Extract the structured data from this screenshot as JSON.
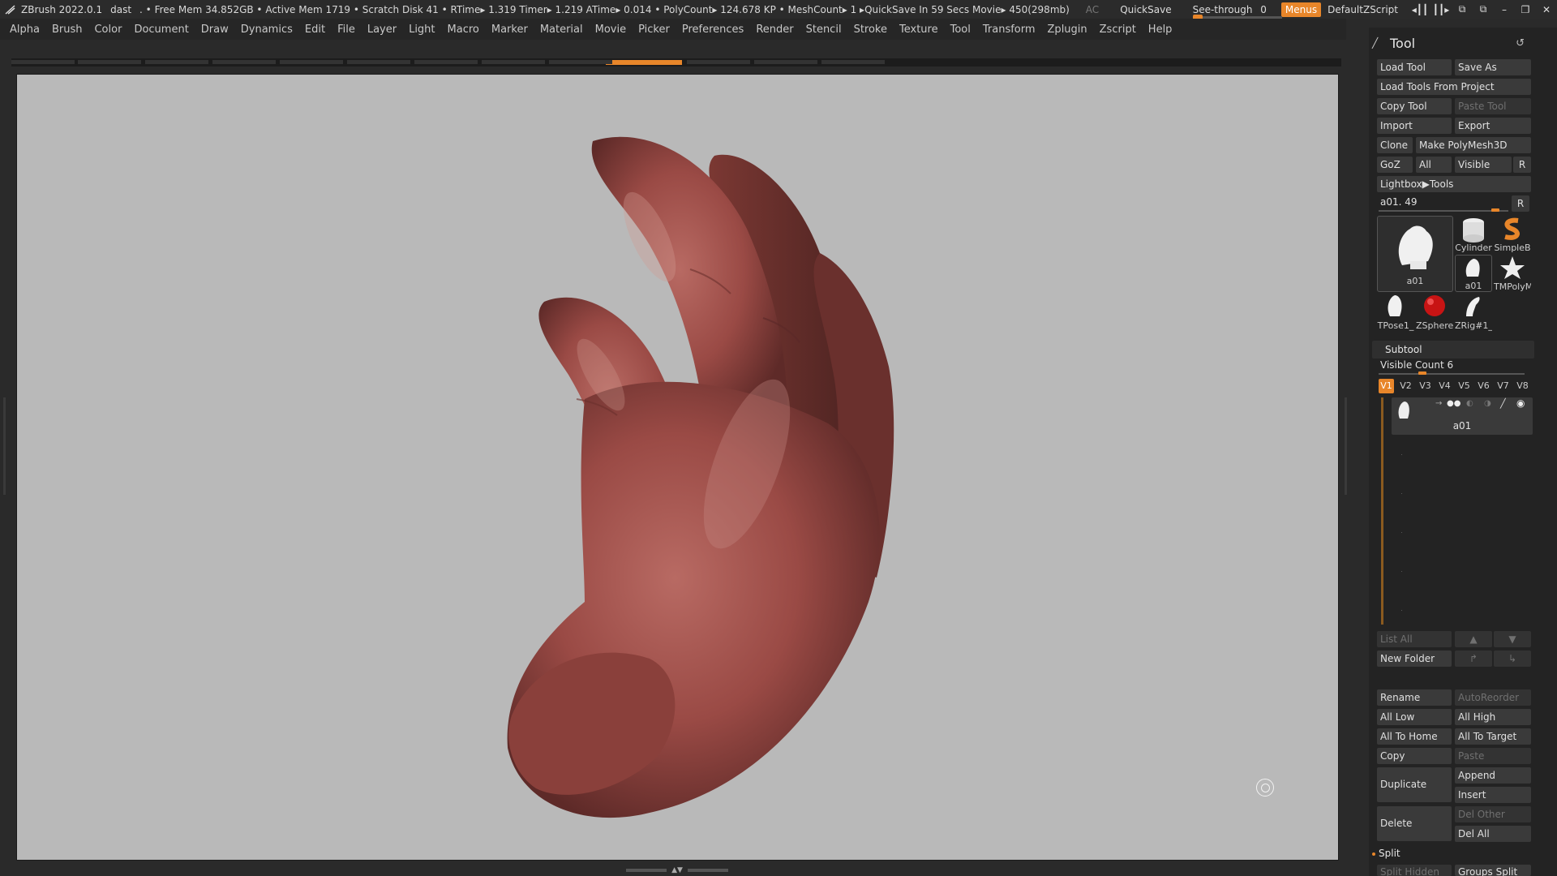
{
  "titlebar": {
    "app": "ZBrush 2022.0.1",
    "project": "dast",
    "status": ". • Free Mem 34.852GB • Active Mem 1719 • Scratch Disk 41 •  RTime▸ 1.319 Timer▸ 1.219 ATime▸ 0.014 • PolyCount▸ 124.678 KP  • MeshCount▸ 1  ▸QuickSave In 59 Secs Movie▸ 450(298mb)",
    "ac": "AC",
    "quicksave": "QuickSave",
    "see_through": "See-through",
    "see_through_value": "0",
    "menus": "Menus",
    "default_zscript": "DefaultZScript"
  },
  "menubar": [
    "Alpha",
    "Brush",
    "Color",
    "Document",
    "Draw",
    "Dynamics",
    "Edit",
    "File",
    "Layer",
    "Light",
    "Macro",
    "Marker",
    "Material",
    "Movie",
    "Picker",
    "Preferences",
    "Render",
    "Stencil",
    "Stroke",
    "Texture",
    "Tool",
    "Transform",
    "Zplugin",
    "Zscript",
    "Help"
  ],
  "tool_panel": {
    "title": "Tool",
    "buttons": {
      "load_tool": "Load Tool",
      "save_as": "Save As",
      "load_tools_from_project": "Load Tools From Project",
      "copy_tool": "Copy Tool",
      "paste_tool": "Paste Tool",
      "import": "Import",
      "export": "Export",
      "clone": "Clone",
      "make_polymesh3d": "Make PolyMesh3D",
      "goz": "GoZ",
      "all": "All",
      "visible": "Visible",
      "r": "R",
      "lightbox_tools": "Lightbox▶Tools"
    },
    "tool_slider": {
      "label": "a01. 49",
      "r": "R",
      "fraction": 0.9
    },
    "thumbnails": [
      {
        "label": "a01",
        "icon": "hand-model-icon"
      },
      {
        "label": "Cylinder",
        "icon": "cylinder-icon"
      },
      {
        "label": "SimpleB",
        "icon": "simple-brush-icon"
      },
      {
        "label": "a01",
        "icon": "hand-model-icon"
      },
      {
        "label": "TMPolyM",
        "icon": "star-polymesh-icon"
      },
      {
        "label": "TPose1_",
        "icon": "hand-model-icon"
      },
      {
        "label": "ZSphere",
        "icon": "zsphere-icon"
      },
      {
        "label": "ZRig#1_",
        "icon": "zrig-icon"
      }
    ]
  },
  "subtool": {
    "title": "Subtool",
    "visible_count_label": "Visible Count 6",
    "visible_count_fraction": 0.3,
    "view_tabs": [
      "V1",
      "V2",
      "V3",
      "V4",
      "V5",
      "V6",
      "V7",
      "V8"
    ],
    "active_tab": "V1",
    "items": [
      {
        "name": "a01"
      }
    ],
    "list_all": "List All",
    "new_folder": "New Folder",
    "rename": "Rename",
    "auto_reorder": "AutoReorder",
    "all_low": "All Low",
    "all_high": "All High",
    "all_to_home": "All To Home",
    "all_to_target": "All To Target",
    "copy": "Copy",
    "paste": "Paste",
    "duplicate": "Duplicate",
    "append": "Append",
    "insert": "Insert",
    "delete": "Delete",
    "del_other": "Del Other",
    "del_all": "Del All"
  },
  "split": {
    "title": "Split",
    "split_hidden": "Split Hidden",
    "groups_split": "Groups Split"
  },
  "colors": {
    "accent": "#e8862a",
    "canvas_bg": "#b9b9b9",
    "skin_base": "#9a4a45"
  }
}
